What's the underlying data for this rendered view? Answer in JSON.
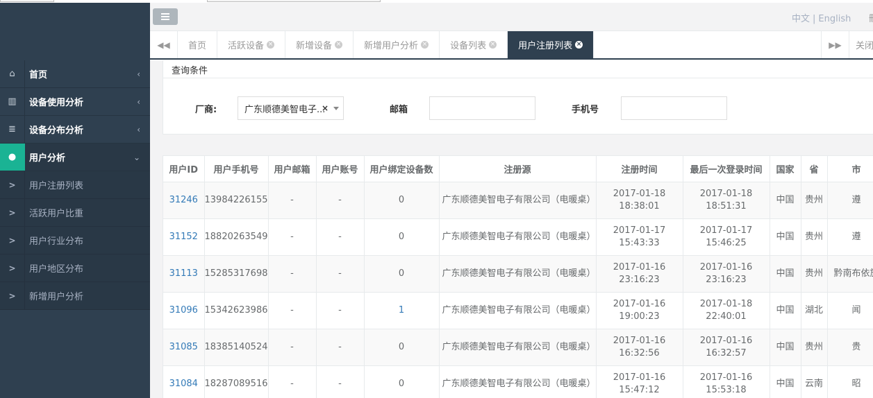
{
  "topbar": {
    "lang_zh": "中文",
    "lang_sep": "|",
    "lang_en": "English",
    "extra": "刪"
  },
  "sidebar": {
    "items": [
      {
        "icon": "home-icon",
        "glyph": "⌂",
        "label": "首页",
        "arrow": "‹"
      },
      {
        "icon": "bar-chart-icon",
        "glyph": "▥",
        "label": "设备使用分析",
        "arrow": "‹"
      },
      {
        "icon": "server-icon",
        "glyph": "≣",
        "label": "设备分布分析",
        "arrow": "‹"
      },
      {
        "icon": "user-icon",
        "glyph": "●",
        "label": "用户分析",
        "arrow": "⌄"
      }
    ],
    "sub_items": [
      {
        "label": "用户注册列表"
      },
      {
        "label": "活跃用户比重"
      },
      {
        "label": "用户行业分布"
      },
      {
        "label": "用户地区分布"
      },
      {
        "label": "新增用户分析"
      }
    ]
  },
  "tabs": {
    "items": [
      {
        "label": "首页",
        "closable": false,
        "active": false
      },
      {
        "label": "活跃设备",
        "closable": true,
        "active": false
      },
      {
        "label": "新增设备",
        "closable": true,
        "active": false
      },
      {
        "label": "新增用户分析",
        "closable": true,
        "active": false
      },
      {
        "label": "设备列表",
        "closable": true,
        "active": false
      },
      {
        "label": "用户注册列表",
        "closable": true,
        "active": true
      }
    ],
    "close_all": "关闭"
  },
  "query": {
    "title": "查询条件",
    "vendor_label": "厂商:",
    "vendor_value": "广东顺德美智电子...",
    "vendor_clear": "×",
    "email_label": "邮箱",
    "phone_label": "手机号"
  },
  "table": {
    "headers": [
      "用户ID",
      "用户手机号",
      "用户邮箱",
      "用户账号",
      "用户绑定设备数",
      "注册源",
      "注册时间",
      "最后一次登录时间",
      "国家",
      "省",
      "市"
    ],
    "rows": [
      {
        "id": "31246",
        "phone": "13984226155",
        "email": "-",
        "account": "-",
        "devices": "0",
        "source": "广东顺德美智电子有限公司（电暖桌）",
        "reg_date": "2017-01-18",
        "reg_time": "18:38:01",
        "login_date": "2017-01-18",
        "login_time": "18:51:31",
        "country": "中国",
        "province": "贵州",
        "city": "遵"
      },
      {
        "id": "31152",
        "phone": "18820263549",
        "email": "-",
        "account": "-",
        "devices": "0",
        "source": "广东顺德美智电子有限公司（电暖桌）",
        "reg_date": "2017-01-17",
        "reg_time": "15:43:33",
        "login_date": "2017-01-17",
        "login_time": "15:46:25",
        "country": "中国",
        "province": "贵州",
        "city": "遵"
      },
      {
        "id": "31113",
        "phone": "15285317698",
        "email": "-",
        "account": "-",
        "devices": "0",
        "source": "广东顺德美智电子有限公司（电暖桌）",
        "reg_date": "2017-01-16",
        "reg_time": "23:16:23",
        "login_date": "2017-01-16",
        "login_time": "23:16:23",
        "country": "中国",
        "province": "贵州",
        "city": "黔南布依族"
      },
      {
        "id": "31096",
        "phone": "15342623986",
        "email": "-",
        "account": "-",
        "devices": "1",
        "source": "广东顺德美智电子有限公司（电暖桌）",
        "reg_date": "2017-01-16",
        "reg_time": "19:00:23",
        "login_date": "2017-01-18",
        "login_time": "22:40:01",
        "country": "中国",
        "province": "湖北",
        "city": "闻"
      },
      {
        "id": "31085",
        "phone": "18385140524",
        "email": "-",
        "account": "-",
        "devices": "0",
        "source": "广东顺德美智电子有限公司（电暖桌）",
        "reg_date": "2017-01-16",
        "reg_time": "16:32:56",
        "login_date": "2017-01-16",
        "login_time": "16:32:57",
        "country": "中国",
        "province": "贵州",
        "city": "贵"
      },
      {
        "id": "31084",
        "phone": "18287089516",
        "email": "-",
        "account": "-",
        "devices": "0",
        "source": "广东顺德美智电子有限公司（电暖桌）",
        "reg_date": "2017-01-16",
        "reg_time": "15:47:12",
        "login_date": "2017-01-16",
        "login_time": "15:53:18",
        "country": "中国",
        "province": "云南",
        "city": "昭"
      }
    ]
  }
}
